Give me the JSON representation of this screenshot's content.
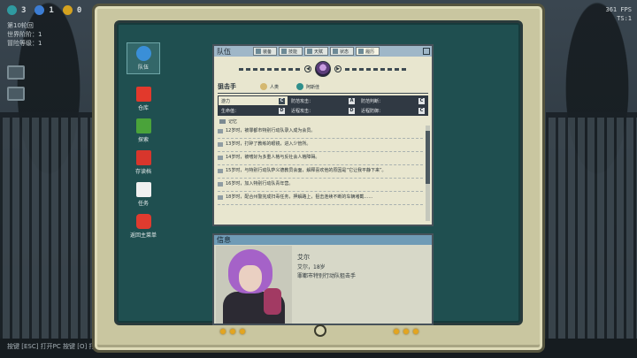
{
  "hud": {
    "resources": [
      {
        "icon": "teal-gem-icon",
        "color": "#2f9aa0",
        "value": "3"
      },
      {
        "icon": "blue-crystal-icon",
        "color": "#3c7dd4",
        "value": "1"
      },
      {
        "icon": "gold-coin-icon",
        "color": "#d4a21f",
        "value": "0"
      }
    ],
    "stats": [
      "第10轮回",
      "世界阶阶：1",
      "冒险等级：1"
    ],
    "fps_line1": "361 FPS",
    "fps_line2": "TS:1",
    "bottom_hint": "按键 [ESC] 打开PC    按键 [O] 打开梦境"
  },
  "desktop": {
    "items": [
      {
        "label": "队伍",
        "icon": "team-icon",
        "color": "#3a8fd8",
        "active": true
      },
      {
        "label": "仓库",
        "icon": "storage-icon",
        "color": "#e2392c",
        "active": false
      },
      {
        "label": "探索",
        "icon": "explore-icon",
        "color": "#4aa33a",
        "active": false
      },
      {
        "label": "存读档",
        "icon": "save-load-icon",
        "color": "#d8362c",
        "active": false
      },
      {
        "label": "任务",
        "icon": "quest-icon",
        "color": "#f0f0f0",
        "active": false
      },
      {
        "label": "返回主菜单",
        "icon": "power-icon",
        "color": "#e03b2f",
        "active": false
      }
    ]
  },
  "team_window": {
    "title": "队伍",
    "tabs": [
      "装备",
      "技能",
      "天赋",
      "状态",
      "履历"
    ],
    "active_tab": "履历",
    "role": "狙击手",
    "person_label": "人类",
    "faction_label": "阿斯佳",
    "stats": [
      [
        "游力",
        "C",
        "防范攻击：",
        "A",
        "防范判断：",
        "C"
      ],
      [
        "生命值：",
        "D",
        "近程攻击：",
        "D",
        "近程防御：",
        "C"
      ]
    ],
    "memory_header": "记忆",
    "memories": [
      "12岁时，被罪都市特别行动队录入成为会员。",
      "13岁时，打碎了教练的眼镜，进入少管所。",
      "14岁时，被嗜好为多重人格与反社会人格障碍。",
      "15岁时，与特别行动队萨义德教员会面，解释喜欢他的原因是“它让我平静下来”。",
      "16岁时，加入特别行动队青年营。",
      "18岁时，配合州警完成扫毒任务，押解路上，狙击连续不断的车辆堵截……"
    ]
  },
  "info_window": {
    "title": "信息",
    "name": "艾尔",
    "line1": "艾尔，18岁",
    "line2": "罪都市特别行动队狙击手"
  }
}
